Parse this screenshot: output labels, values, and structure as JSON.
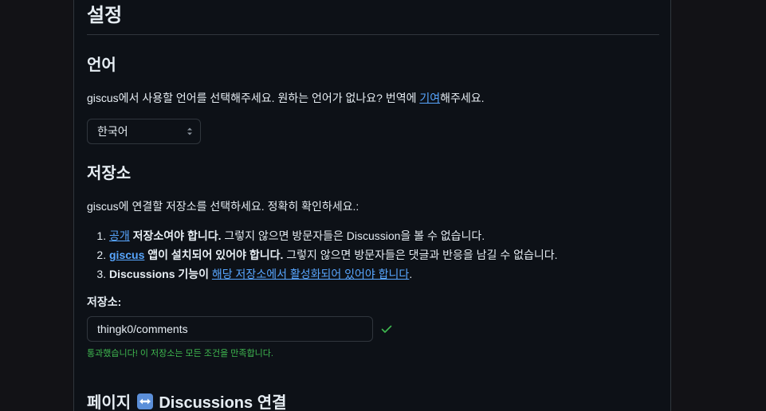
{
  "settings": {
    "title": "설정"
  },
  "language": {
    "heading": "언어",
    "description_before": "giscus에서 사용할 언어를 선택해주세요. 원하는 언어가 없나요? 번역에 ",
    "contribute_link": "기여",
    "description_after": "해주세요.",
    "selected_option": "한국어"
  },
  "repository": {
    "heading": "저장소",
    "description": "giscus에 연결할 저장소를 선택하세요. 정확히 확인하세요.:",
    "requirements": [
      {
        "link": "공개",
        "bold_text": " 저장소여야 합니다.",
        "text": " 그렇지 않으면 방문자들은 Discussion을 볼 수 없습니다."
      },
      {
        "link": "giscus",
        "bold_text": " 앱이 설치되어 있어야 합니다.",
        "text": " 그렇지 않으면 방문자들은 댓글과 반응을 남길 수 없습니다."
      },
      {
        "bold_text": "Discussions 기능이 ",
        "link": "해당 저장소에서 활성화되어 있어야 합니다",
        "text": "."
      }
    ],
    "input_label": "저장소:",
    "input_value": "thingk0/comments",
    "success_message": "통과했습니다! 이 저장소는 모든 조건을 만족합니다.",
    "status_icon": "check-icon",
    "success_color": "#3fb950",
    "link_color": "#58a6ff"
  },
  "mapping": {
    "heading_before": "페이지 ",
    "emoji_icon": "left-right-arrow-icon",
    "heading_after": " Discussions 연결"
  }
}
